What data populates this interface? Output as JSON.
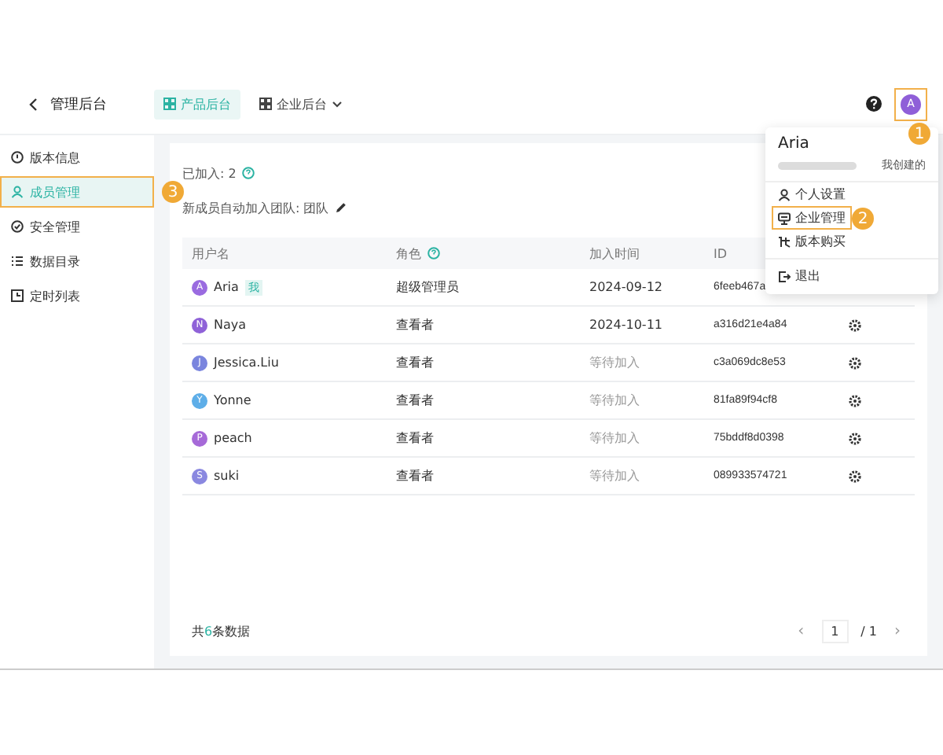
{
  "header": {
    "back_label": "管理后台",
    "tabs": [
      {
        "label": "产品后台",
        "selected": true,
        "dropdown": false
      },
      {
        "label": "企业后台",
        "selected": false,
        "dropdown": true
      }
    ],
    "avatar": {
      "initial": "A",
      "highlighted": true,
      "callout": "1"
    }
  },
  "sidebar": {
    "items": [
      {
        "label": "版本信息",
        "selected": false,
        "highlighted": false
      },
      {
        "label": "成员管理",
        "selected": true,
        "highlighted": true,
        "callout": "3"
      },
      {
        "label": "安全管理",
        "selected": false,
        "highlighted": false
      },
      {
        "label": "数据目录",
        "selected": false,
        "highlighted": false
      },
      {
        "label": "定时列表",
        "selected": false,
        "highlighted": false
      }
    ]
  },
  "members": {
    "joined_label": "已加入: 2",
    "auto_join_label": "新成员自动加入团队: 团队",
    "columns": [
      "用户名",
      "角色",
      "加入时间",
      "ID"
    ],
    "rows": [
      {
        "initial": "A",
        "color": "#9a6be0",
        "name": "Aria",
        "tag": "我",
        "role": "超级管理员",
        "joined": "2024-09-12",
        "pending": false,
        "id": "6feeb467a"
      },
      {
        "initial": "N",
        "color": "#8f62d8",
        "name": "Naya",
        "role": "查看者",
        "joined": "2024-10-11",
        "pending": false,
        "id": "a316d21e4a84",
        "settings": true
      },
      {
        "initial": "J",
        "color": "#7a85de",
        "name": "Jessica.Liu",
        "role": "查看者",
        "joined": "等待加入",
        "pending": true,
        "id": "c3a069dc8e53",
        "settings": true
      },
      {
        "initial": "Y",
        "color": "#5eaee8",
        "name": "Yonne",
        "role": "查看者",
        "joined": "等待加入",
        "pending": true,
        "id": "81fa89f94cf8",
        "settings": true
      },
      {
        "initial": "P",
        "color": "#a66ad8",
        "name": "peach",
        "role": "查看者",
        "joined": "等待加入",
        "pending": true,
        "id": "75bddf8d0398",
        "settings": true
      },
      {
        "initial": "S",
        "color": "#8a88e0",
        "name": "suki",
        "role": "查看者",
        "joined": "等待加入",
        "pending": true,
        "id": "089933574721",
        "settings": true
      }
    ],
    "footer": {
      "prefix": "共",
      "count": "6",
      "suffix": "条数据"
    },
    "pagination": {
      "prev": "‹",
      "page": "1",
      "total": "/ 1",
      "next": "›"
    }
  },
  "user_menu": {
    "name": "Aria",
    "badge": "我创建的",
    "items": [
      {
        "kind": "item",
        "label": "个人设置",
        "highlighted": false
      },
      {
        "kind": "item",
        "label": "企业管理",
        "highlighted": true,
        "callout": "2"
      },
      {
        "kind": "item",
        "label": "版本购买",
        "highlighted": false
      },
      {
        "kind": "divider"
      },
      {
        "kind": "item",
        "label": "退出",
        "highlighted": false
      }
    ]
  }
}
